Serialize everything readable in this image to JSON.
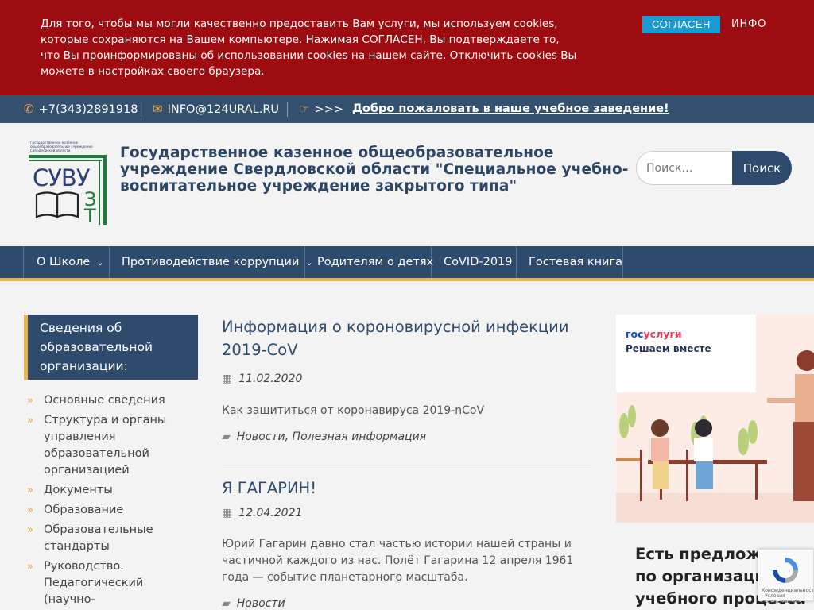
{
  "cookie": {
    "text": "Для того, чтобы мы могли качественно предоставить Вам услуги, мы используем cookies, которые сохраняются на Вашем компьютере. Нажимая СОГЛАСЕН, Вы подтверждаете то, что Вы проинформированы об использовании cookies на нашем сайте. Отключить cookies Вы можете в настройках своего браузера.",
    "agree_label": "СОГЛАСЕН",
    "info_label": "ИНФО"
  },
  "topbar": {
    "phone": "+7(343)2891918",
    "email": "INFO@124URAL.RU",
    "arrows": ">>>",
    "welcome": "Добро пожаловать в наше учебное заведение!"
  },
  "header": {
    "logo_caption": "Государственное казенное общеобразовательное учреждение Свердловской области",
    "logo_letters_1": "СУВУ",
    "logo_letters_2": "ЗТ",
    "site_title": "Государственное казенное общеобразовательное учреждение Свердловской области \"Специальное учебно-воспитательное учреждение закрытого типа\"",
    "search_placeholder": "Поиск…",
    "search_button": "Поиск"
  },
  "nav": {
    "items": [
      {
        "label": "О Школе"
      },
      {
        "label": "Противодействие коррупции"
      },
      {
        "label": "Родителям о детях"
      },
      {
        "label": "CoVID-2019"
      },
      {
        "label": "Гостевая книга"
      }
    ]
  },
  "sidebar": {
    "heading": "Сведения об образовательной организации:",
    "items": [
      {
        "label": "Основные сведения"
      },
      {
        "label": "Структура и органы управления образовательной организацией"
      },
      {
        "label": "Документы"
      },
      {
        "label": "Образование"
      },
      {
        "label": "Образовательные стандарты"
      },
      {
        "label": "Руководство. Педагогический (научно-педагогический) состав"
      }
    ]
  },
  "posts": [
    {
      "title": "Информация о короновирусной инфекции 2019-CoV",
      "date": "11.02.2020",
      "excerpt": "Как защититься от коронавируса 2019-nCoV",
      "categories": "Новости, Полезная информация"
    },
    {
      "title": "Я ГАГАРИН!",
      "date": "12.04.2021",
      "excerpt": "Юрий Гагарин давно стал частью истории нашей страны и частичной каждого из нас. Полёт Гагарина 12 апреля 1961 года — событие планетарного масштаба.",
      "categories": "Новости"
    }
  ],
  "banner": {
    "logo_gos": "гос",
    "logo_uslugi": "услуги",
    "subtitle": "Решаем вместе",
    "promo": "Есть предложения по организации учебного процесса или знаете, как"
  },
  "recaptcha": {
    "text": "Конфиденциальность - Условия использования"
  },
  "colors": {
    "cookie_bg": "#9c0c10",
    "agree_btn": "#1a9bd0",
    "brand_navy": "#2e4a6c",
    "accent_gold": "#e6b34d",
    "topbar_bg": "#34506f"
  }
}
